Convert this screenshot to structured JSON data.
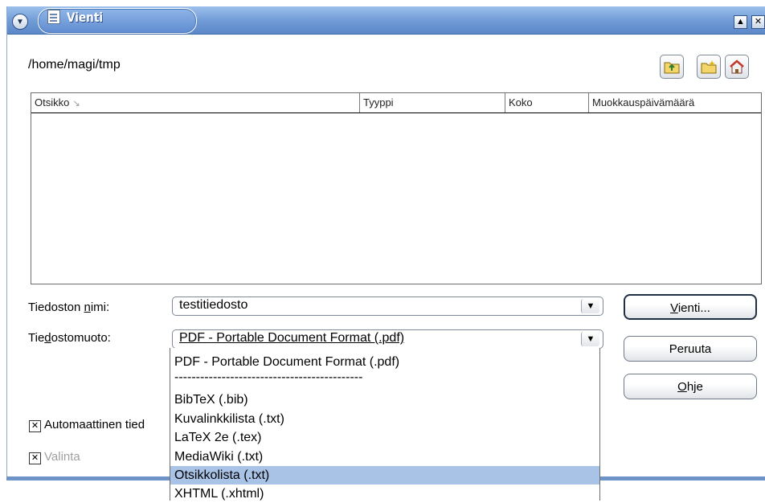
{
  "window": {
    "title": "Vienti"
  },
  "toolbar": {
    "path": "/home/magi/tmp",
    "icons": [
      "folder-up-icon",
      "new-folder-icon",
      "home-icon"
    ]
  },
  "file_list": {
    "columns": [
      "Otsikko",
      "Tyyppi",
      "Koko",
      "Muokkauspäivämäärä"
    ],
    "sort_indicator": "↘",
    "rows": []
  },
  "form": {
    "filename_label_pre": "Tiedoston ",
    "filename_label_u": "n",
    "filename_label_post": "imi:",
    "filename_value": "testitiedosto",
    "format_label_pre": "Tie",
    "format_label_u": "d",
    "format_label_post": "ostomuoto:",
    "format_value": "PDF - Portable Document Format (.pdf)"
  },
  "buttons": {
    "export_pre": "",
    "export_u": "V",
    "export_post": "ienti...",
    "cancel": "Peruuta",
    "help_pre": "",
    "help_u": "O",
    "help_post": "hje"
  },
  "checkboxes": {
    "auto_label": "Automaattinen tied",
    "auto_checked": true,
    "selection_label": "Valinta",
    "selection_checked": true,
    "selection_disabled": true
  },
  "dropdown": {
    "options": [
      "PDF - Portable Document Format (.pdf)",
      "--------------------------------------------",
      "BibTeX (.bib)",
      "Kuvalinkkilista (.txt)",
      "LaTeX 2e (.tex)",
      "MediaWiki (.txt)",
      "Otsikkolista (.txt)",
      "XHTML (.xhtml)"
    ],
    "selected_index": 6
  },
  "colors": {
    "titlebar": "#6f9ad6",
    "selection": "#a8c3e6"
  }
}
